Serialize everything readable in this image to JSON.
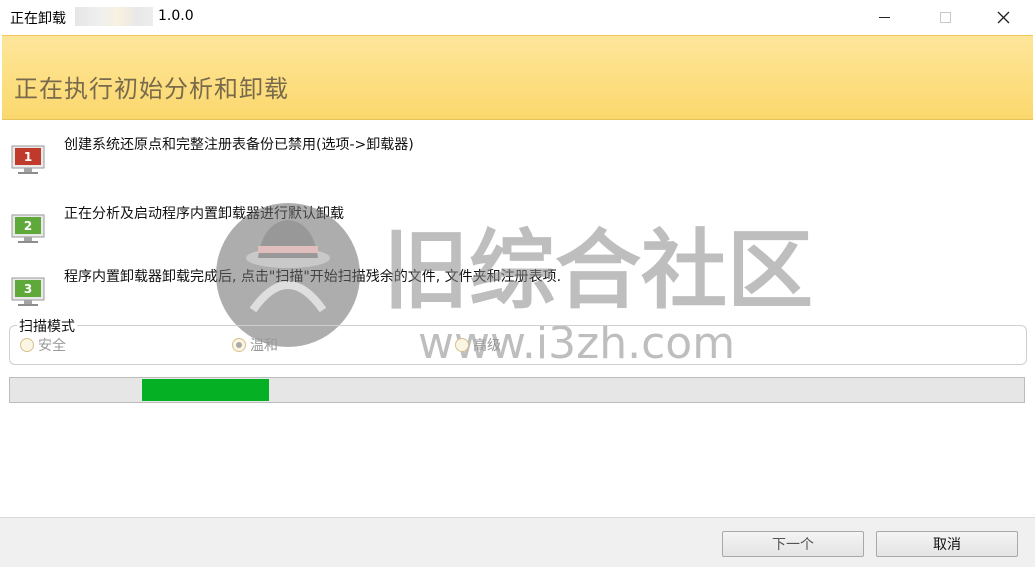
{
  "window": {
    "title": "正在卸载",
    "version": "1.0.0"
  },
  "header": {
    "title": "正在执行初始分析和卸载"
  },
  "steps": [
    {
      "number": "1",
      "color": "#c0392b",
      "text": "创建系统还原点和完整注册表备份已禁用(选项->卸载器)"
    },
    {
      "number": "2",
      "color": "#5fa83a",
      "text": "正在分析及启动程序内置卸载器进行默认卸载"
    },
    {
      "number": "3",
      "color": "#5fa83a",
      "text": "程序内置卸载器卸载完成后, 点击\"扫描\"开始扫描残余的文件, 文件夹和注册表项."
    }
  ],
  "scan_mode": {
    "label": "扫描模式",
    "options": [
      {
        "label": "安全",
        "checked": false
      },
      {
        "label": "温和",
        "checked": true
      },
      {
        "label": "高级",
        "checked": false
      }
    ]
  },
  "progress": {
    "start_fraction": 0.13,
    "end_fraction": 0.255,
    "color": "#06b025"
  },
  "watermark": {
    "text_cn": "旧综合社区",
    "text_url": "www.i3zh.com"
  },
  "footer": {
    "next_label": "下一个",
    "cancel_label": "取消"
  }
}
